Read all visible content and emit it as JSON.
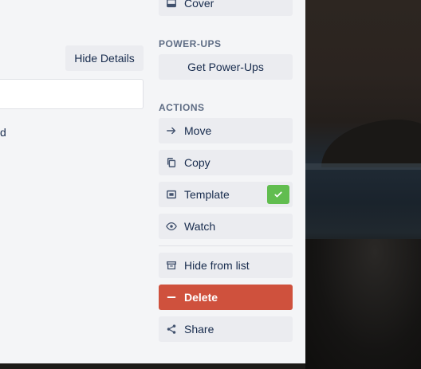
{
  "top": {
    "cover_label": "Cover",
    "hide_details_label": "Hide Details",
    "partial_text": "d"
  },
  "powerups": {
    "heading": "POWER-UPS",
    "get_label": "Get Power-Ups"
  },
  "actions": {
    "heading": "ACTIONS",
    "move": "Move",
    "copy": "Copy",
    "template": "Template",
    "template_enabled": true,
    "watch": "Watch",
    "hide": "Hide from list",
    "delete": "Delete",
    "share": "Share"
  },
  "colors": {
    "delete_bg": "#cf513d",
    "check_bg": "#61bd4f",
    "panel_bg": "#f4f5f7",
    "button_bg": "#ebecf0"
  }
}
